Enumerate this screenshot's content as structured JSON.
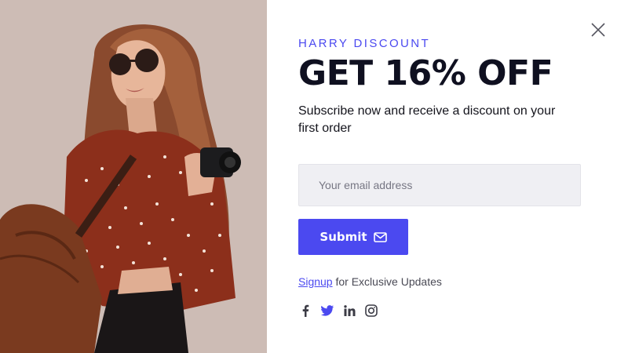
{
  "popup": {
    "eyebrow": "HARRY DISCOUNT",
    "headline": "GET 16% OFF",
    "subtitle": "Subscribe now and receive a discount on your first order",
    "email_placeholder": "Your email address",
    "submit_label": "Submit",
    "signup_link": "Signup",
    "signup_suffix": " for Exclusive Updates",
    "social_icons": [
      "facebook-icon",
      "twitter-icon",
      "linkedin-icon",
      "instagram-icon"
    ]
  },
  "colors": {
    "accent": "#4b49f0",
    "headline": "#0f1020",
    "input_bg": "#efeff3",
    "photo_bg": "#cdbcb5"
  }
}
